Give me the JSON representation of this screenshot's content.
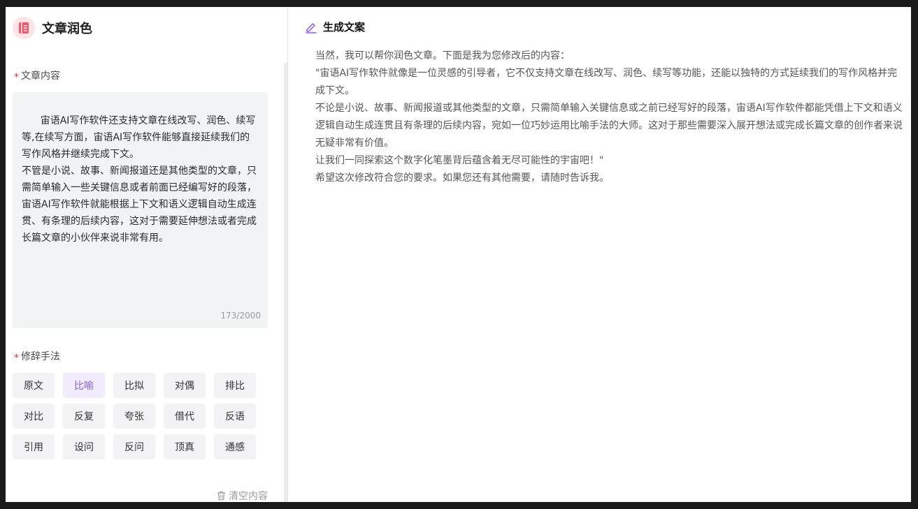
{
  "app": {
    "title": "文章润色",
    "logo_icon": "book-icon",
    "accent": "#8a5cf0",
    "logo_color": "#f05a6a"
  },
  "article": {
    "label": "文章内容",
    "required_mark": "*",
    "content": "宙语AI写作软件还支持文章在线改写、润色、续写等,在续写方面，宙语AI写作软件能够直接延续我们的写作风格并继续完成下文。\n不管是小说、故事、新闻报道还是其他类型的文章，只需简单输入一些关键信息或者前面已经编写好的段落，宙语AI写作软件就能根据上下文和语义逻辑自动生成连贯、有条理的后续内容，这对于需要延伸想法或者完成长篇文章的小伙伴来说非常有用。",
    "counter": "173/2000"
  },
  "rhetoric": {
    "label": "修辞手法",
    "required_mark": "*",
    "options": [
      "原文",
      "比喻",
      "比拟",
      "对偶",
      "排比",
      "对比",
      "反复",
      "夸张",
      "借代",
      "反语",
      "引用",
      "设问",
      "反问",
      "顶真",
      "通感"
    ],
    "selected": "比喻"
  },
  "clear": {
    "label": "清空内容",
    "icon": "trash-icon"
  },
  "output": {
    "title": "生成文案",
    "icon": "pencil-icon",
    "paragraphs": [
      "当然，我可以帮你润色文章。下面是我为您修改后的内容：",
      "\"宙语AI写作软件就像是一位灵感的引导者，它不仅支持文章在线改写、润色、续写等功能，还能以独特的方式延续我们的写作风格并完成下文。",
      "不论是小说、故事、新闻报道或其他类型的文章，只需简单输入关键信息或之前已经写好的段落，宙语AI写作软件都能凭借上下文和语义逻辑自动生成连贯且有条理的后续内容，宛如一位巧妙运用比喻手法的大师。这对于那些需要深入展开想法或完成长篇文章的创作者来说无疑非常有价值。",
      "让我们一同探索这个数字化笔墨背后蕴含着无尽可能性的宇宙吧！\"",
      "希望这次修改符合您的要求。如果您还有其他需要，请随时告诉我。"
    ]
  }
}
